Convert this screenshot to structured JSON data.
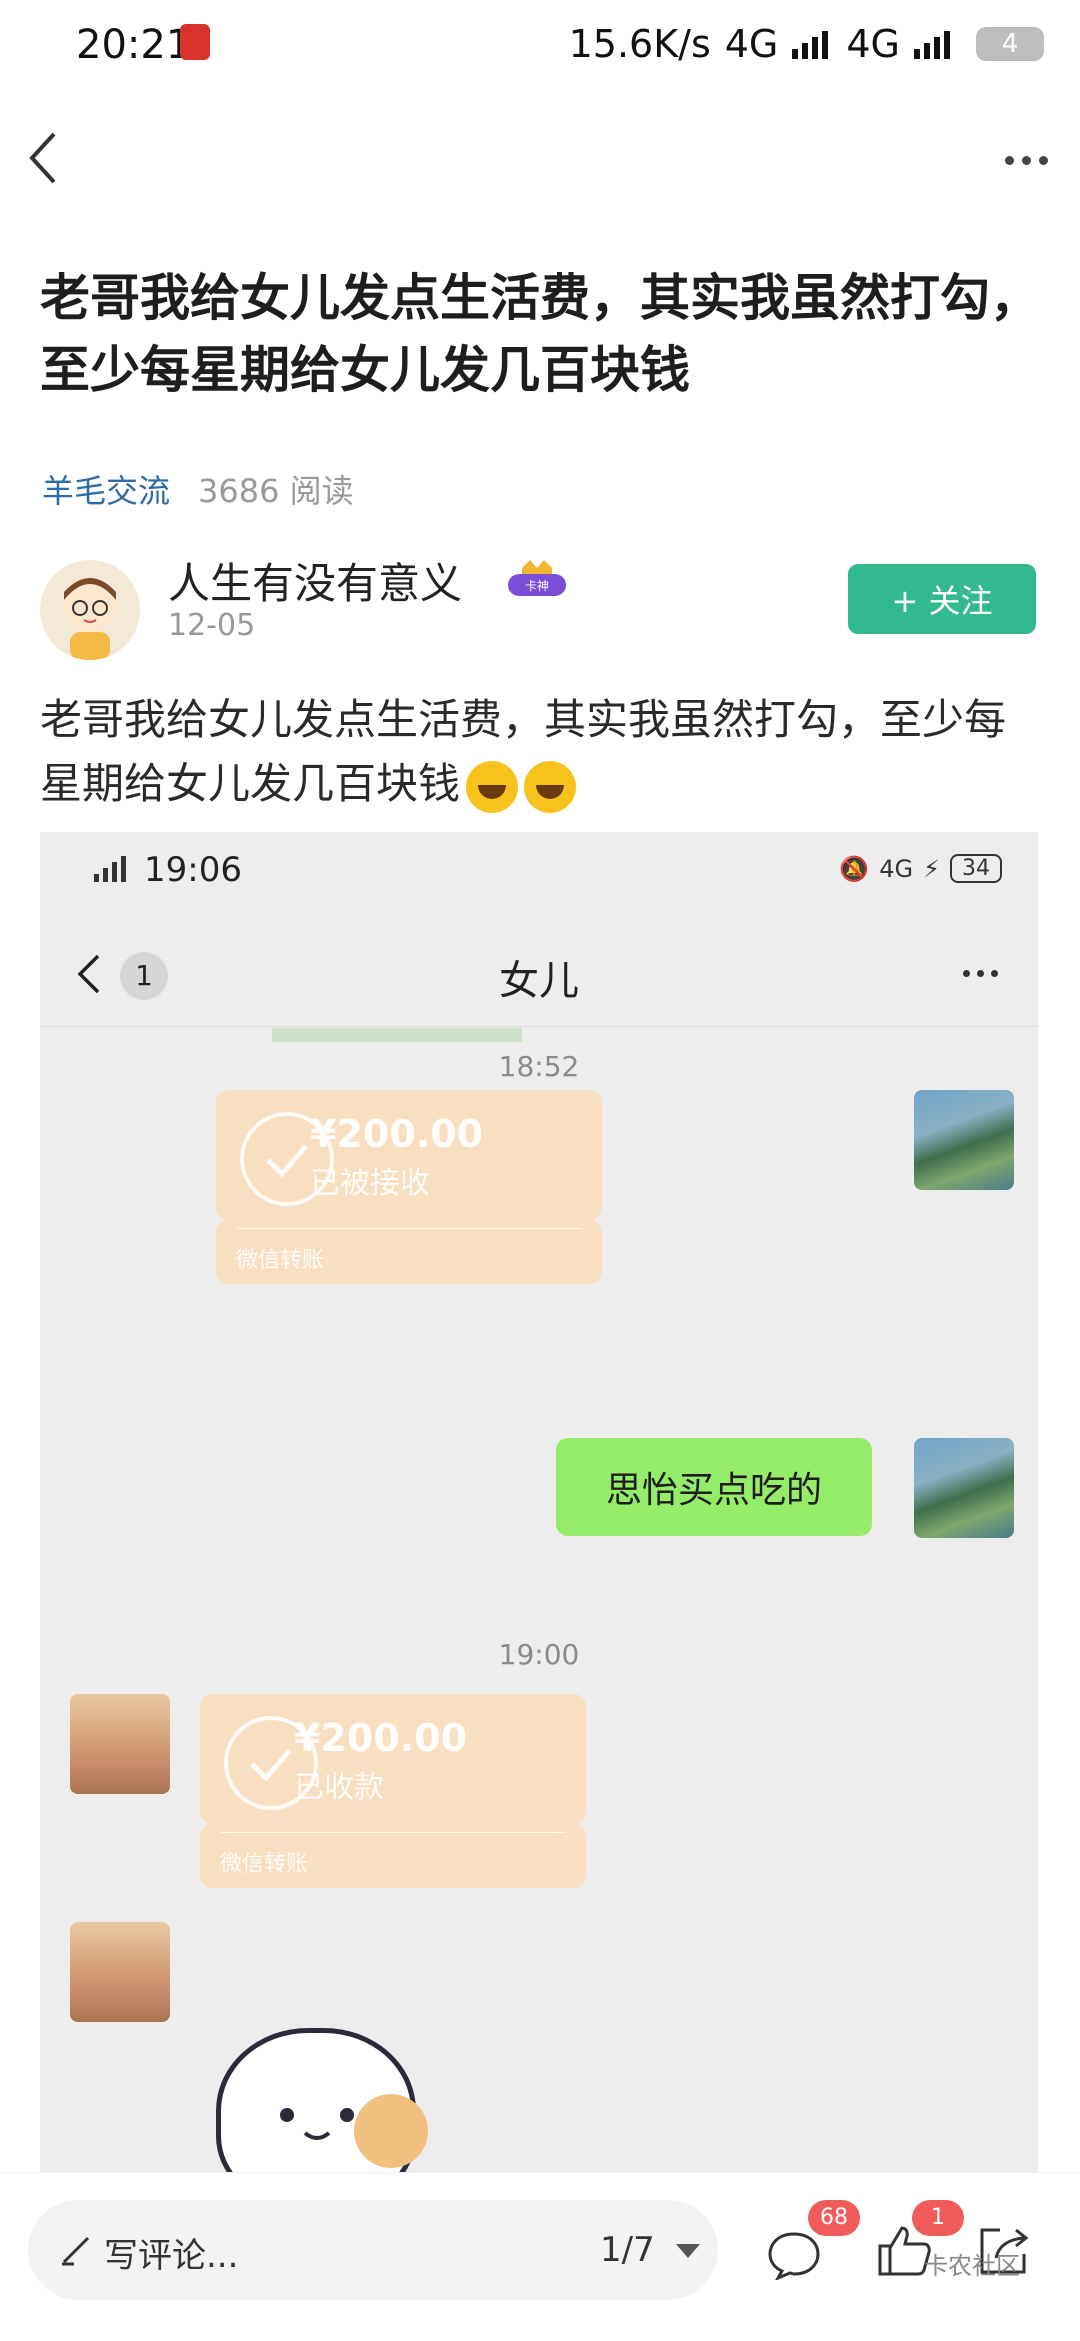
{
  "status_bar": {
    "time": "20:21",
    "speed": "15.6K/s",
    "net1": "4G",
    "net2": "4G",
    "battery": "4"
  },
  "post": {
    "title": "老哥我给女儿发点生活费，其实我虽然打勾，至少每星期给女儿发几百块钱",
    "category": "羊毛交流",
    "reads": "3686 阅读",
    "author": {
      "name": "人生有没有意义",
      "badge": "卡神",
      "date": "12-05"
    },
    "follow_label": "+ 关注",
    "body": "老哥我给女儿发点生活费，其实我虽然打勾，至少每星期给女儿发几百块钱"
  },
  "screenshot": {
    "status_time": "19:06",
    "battery": "34",
    "net": "4G",
    "back_count": "1",
    "chat_title": "女儿",
    "messages": [
      {
        "type": "timestamp",
        "text": "18:52"
      },
      {
        "type": "transfer",
        "amount": "¥200.00",
        "status": "已被接收",
        "footer": "微信转账",
        "side": "right"
      },
      {
        "type": "text",
        "text": "思怡买点吃的",
        "side": "right"
      },
      {
        "type": "timestamp",
        "text": "19:00"
      },
      {
        "type": "transfer",
        "amount": "¥200.00",
        "status": "已收款",
        "footer": "微信转账",
        "side": "left"
      },
      {
        "type": "sticker",
        "side": "left"
      }
    ]
  },
  "bottom_bar": {
    "comment_placeholder": "写评论...",
    "pager": "1/7",
    "comments_count": "68",
    "likes_count": "1",
    "watermark": "卡农社区"
  }
}
